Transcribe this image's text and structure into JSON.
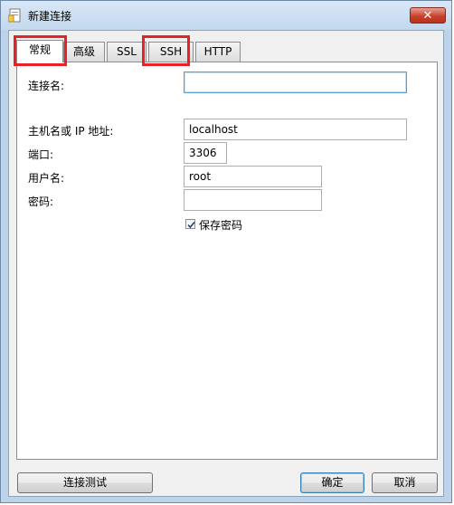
{
  "window": {
    "title": "新建连接",
    "close_glyph": "✕"
  },
  "tabs": [
    {
      "label": "常规",
      "active": true,
      "highlighted": true
    },
    {
      "label": "高级",
      "active": false,
      "highlighted": false
    },
    {
      "label": "SSL",
      "active": false,
      "highlighted": false
    },
    {
      "label": "SSH",
      "active": false,
      "highlighted": true
    },
    {
      "label": "HTTP",
      "active": false,
      "highlighted": false
    }
  ],
  "form": {
    "connection_name": {
      "label": "连接名:",
      "value": ""
    },
    "host": {
      "label": "主机名或 IP 地址:",
      "value": "localhost"
    },
    "port": {
      "label": "端口:",
      "value": "3306"
    },
    "username": {
      "label": "用户名:",
      "value": "root"
    },
    "password": {
      "label": "密码:",
      "value": ""
    },
    "save_password": {
      "label": "保存密码",
      "checked": true
    }
  },
  "buttons": {
    "test": "连接测试",
    "ok": "确定",
    "cancel": "取消"
  },
  "colors": {
    "highlight": "#e82127",
    "frame": "#bcd3ea"
  },
  "icons": {
    "title": "app-document-icon",
    "close": "close-icon",
    "check": "check-icon"
  }
}
